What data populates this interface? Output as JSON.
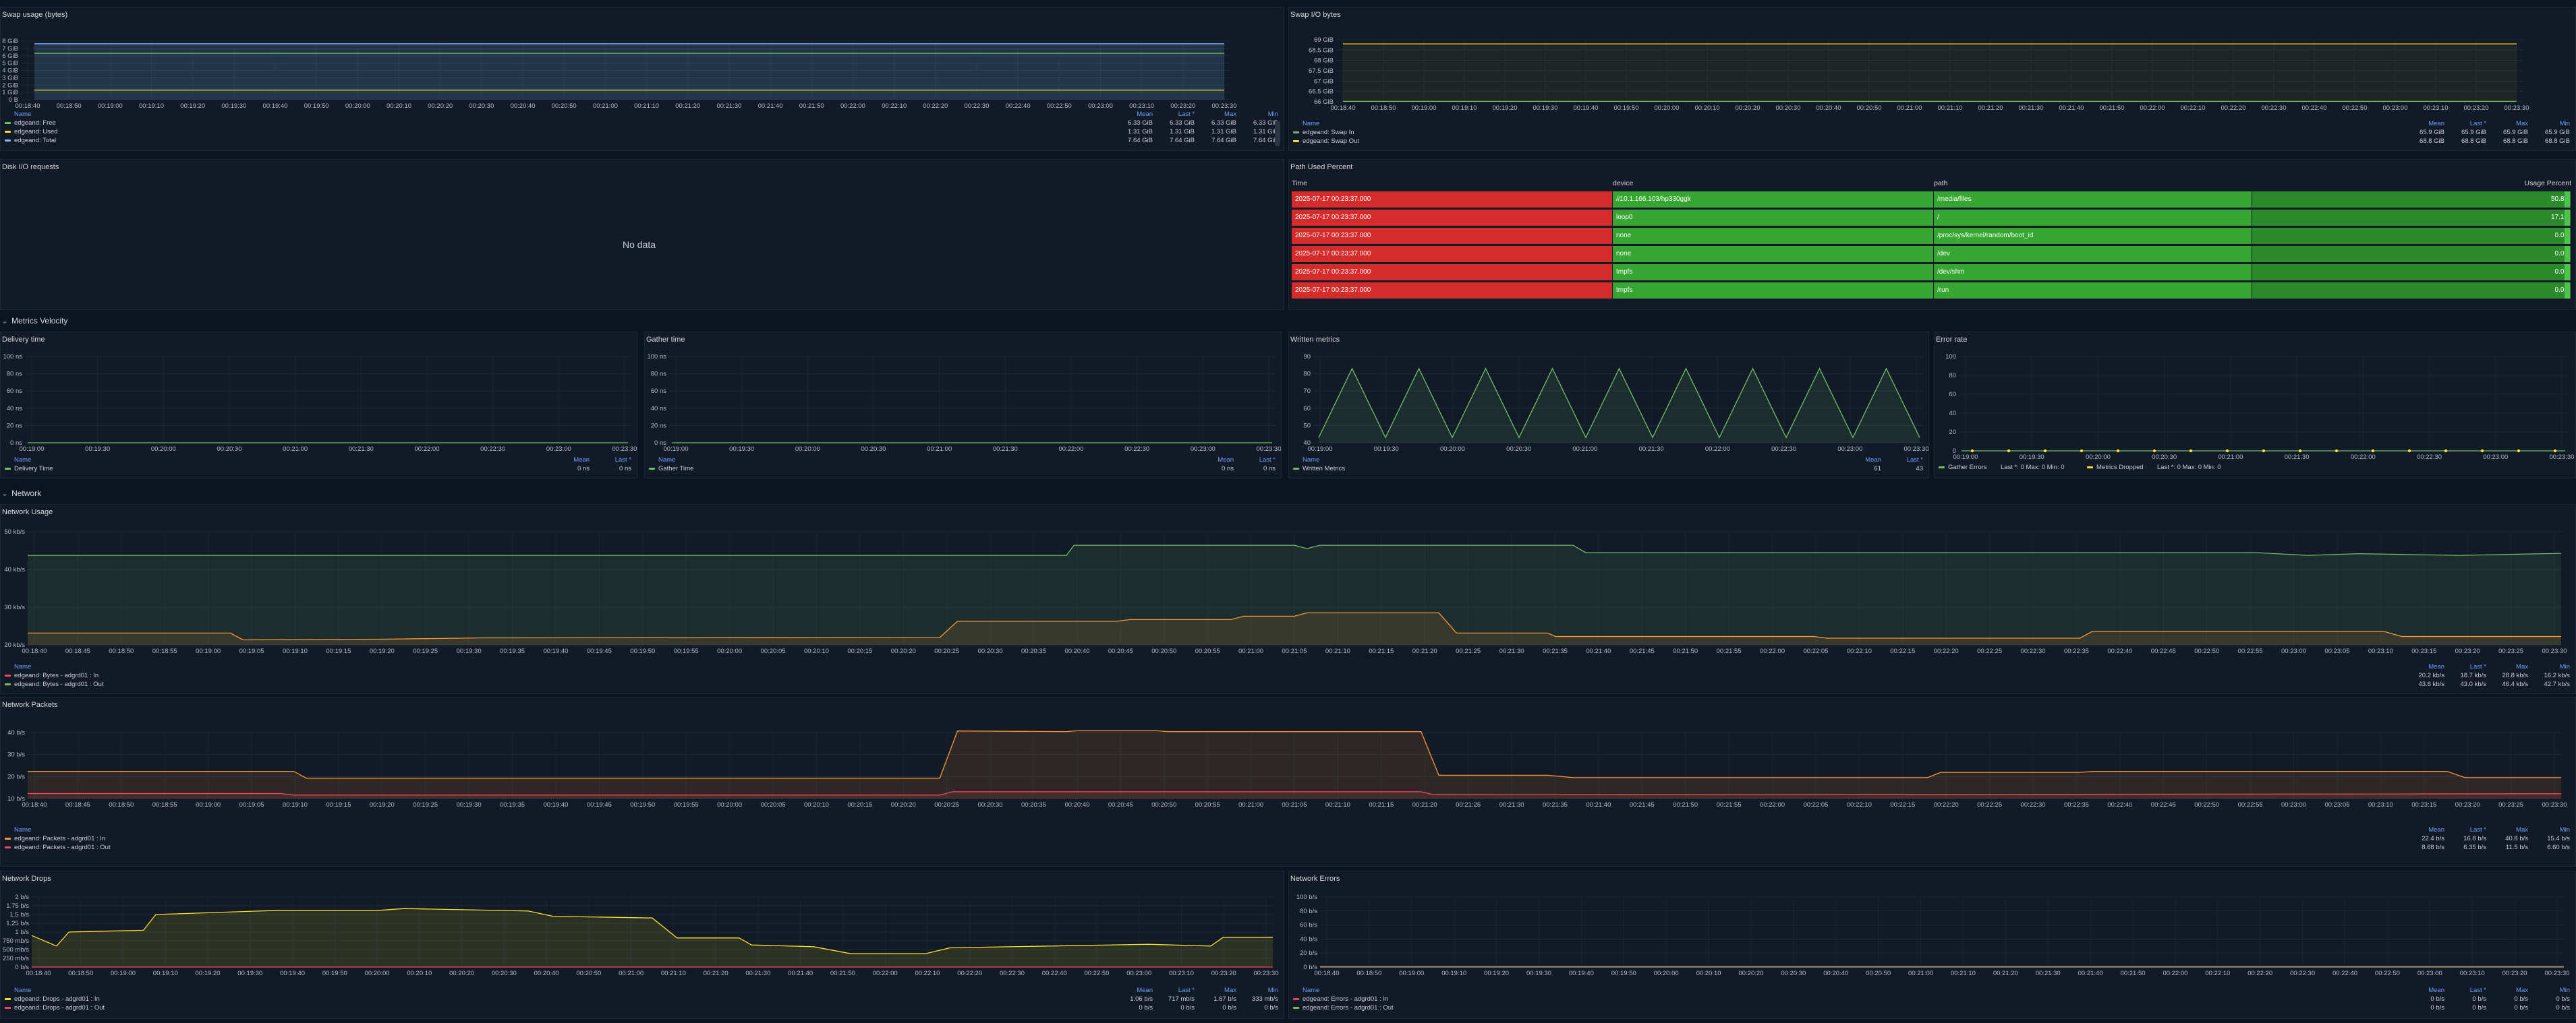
{
  "panels": {
    "swap_usage": {
      "title": "Swap usage (bytes)",
      "y_ticks": [
        "8 GiB",
        "7 GiB",
        "6 GiB",
        "5 GiB",
        "4 GiB",
        "3 GiB",
        "2 GiB",
        "1 GiB",
        "0 B"
      ],
      "x_ticks": [
        "00:18:40",
        "00:18:50",
        "00:19:00",
        "00:19:10",
        "00:19:20",
        "00:19:30",
        "00:19:40",
        "00:19:50",
        "00:20:00",
        "00:20:10",
        "00:20:20",
        "00:20:30",
        "00:20:40",
        "00:20:50",
        "00:21:00",
        "00:21:10",
        "00:21:20",
        "00:21:30",
        "00:21:40",
        "00:21:50",
        "00:22:00",
        "00:22:10",
        "00:22:20",
        "00:22:30",
        "00:22:40",
        "00:22:50",
        "00:23:00",
        "00:23:10",
        "00:23:20",
        "00:23:30"
      ],
      "legend_cols": [
        "Mean",
        "Last *",
        "Max",
        "Min"
      ],
      "legend": [
        {
          "name": "edgeand: Free",
          "color": "#73bf69",
          "vals": [
            "6.33 GiB",
            "6.33 GiB",
            "6.33 GiB",
            "6.33 GiB"
          ]
        },
        {
          "name": "edgeand: Used",
          "color": "#fade2a",
          "vals": [
            "1.31 GiB",
            "1.31 GiB",
            "1.31 GiB",
            "1.31 GiB"
          ]
        },
        {
          "name": "edgeand: Total",
          "color": "#8ab8ff",
          "vals": [
            "7.64 GiB",
            "7.64 GiB",
            "7.64 GiB",
            "7.64 GiB"
          ]
        }
      ]
    },
    "swap_io": {
      "title": "Swap I/O bytes",
      "y_ticks": [
        "69 GiB",
        "68.5 GiB",
        "68 GiB",
        "67.5 GiB",
        "67 GiB",
        "66.5 GiB",
        "66 GiB"
      ],
      "x_ticks": [
        "00:18:40",
        "00:18:50",
        "00:19:00",
        "00:19:10",
        "00:19:20",
        "00:19:30",
        "00:19:40",
        "00:19:50",
        "00:20:00",
        "00:20:10",
        "00:20:20",
        "00:20:30",
        "00:20:40",
        "00:20:50",
        "00:21:00",
        "00:21:10",
        "00:21:20",
        "00:21:30",
        "00:21:40",
        "00:21:50",
        "00:22:00",
        "00:22:10",
        "00:22:20",
        "00:22:30",
        "00:22:40",
        "00:22:50",
        "00:23:00",
        "00:23:10",
        "00:23:20",
        "00:23:30"
      ],
      "legend_cols": [
        "Mean",
        "Last *",
        "Max",
        "Min"
      ],
      "legend": [
        {
          "name": "edgeand: Swap In",
          "color": "#73bf69",
          "vals": [
            "65.9 GiB",
            "65.9 GiB",
            "65.9 GiB",
            "65.9 GiB"
          ]
        },
        {
          "name": "edgeand: Swap Out",
          "color": "#fade2a",
          "vals": [
            "68.8 GiB",
            "68.8 GiB",
            "68.8 GiB",
            "68.8 GiB"
          ]
        }
      ]
    },
    "disk_io": {
      "title": "Disk I/O requests",
      "no_data": "No data"
    },
    "path_used": {
      "title": "Path Used Percent",
      "columns": [
        "Time",
        "device",
        "path",
        "Usage Percent"
      ],
      "rows": [
        {
          "time": "2025-07-17 00:23:37.000",
          "device": "//10.1.166.103/hp330ggk",
          "path": "/media/files",
          "pct": "50.84"
        },
        {
          "time": "2025-07-17 00:23:37.000",
          "device": "loop0",
          "path": "/",
          "pct": "17.10"
        },
        {
          "time": "2025-07-17 00:23:37.000",
          "device": "none",
          "path": "/proc/sys/kernel/random/boot_id",
          "pct": "0.01"
        },
        {
          "time": "2025-07-17 00:23:37.000",
          "device": "none",
          "path": "/dev",
          "pct": "0.01"
        },
        {
          "time": "2025-07-17 00:23:37.000",
          "device": "tmpfs",
          "path": "/dev/shm",
          "pct": "0.01"
        },
        {
          "time": "2025-07-17 00:23:37.000",
          "device": "tmpfs",
          "path": "/run",
          "pct": "0.01"
        }
      ]
    },
    "delivery": {
      "title": "Delivery time",
      "y_ticks": [
        "100 ns",
        "80 ns",
        "60 ns",
        "40 ns",
        "20 ns",
        "0 ns"
      ],
      "x_ticks": [
        "00:19:00",
        "00:19:30",
        "00:20:00",
        "00:20:30",
        "00:21:00",
        "00:21:30",
        "00:22:00",
        "00:22:30",
        "00:23:00",
        "00:23:30"
      ],
      "legend_cols": [
        "Mean",
        "Last *"
      ],
      "legend": [
        {
          "name": "Delivery Time",
          "color": "#73bf69",
          "vals": [
            "0 ns",
            "0 ns"
          ]
        }
      ]
    },
    "gather": {
      "title": "Gather time",
      "y_ticks": [
        "100 ns",
        "80 ns",
        "60 ns",
        "40 ns",
        "20 ns",
        "0 ns"
      ],
      "x_ticks": [
        "00:19:00",
        "00:19:30",
        "00:20:00",
        "00:20:30",
        "00:21:00",
        "00:21:30",
        "00:22:00",
        "00:22:30",
        "00:23:00",
        "00:23:30"
      ],
      "legend_cols": [
        "Mean",
        "Last *"
      ],
      "legend": [
        {
          "name": "Gather Time",
          "color": "#73bf69",
          "vals": [
            "0 ns",
            "0 ns"
          ]
        }
      ]
    },
    "written": {
      "title": "Written metrics",
      "y_ticks": [
        "90",
        "80",
        "70",
        "60",
        "50",
        "40"
      ],
      "x_ticks": [
        "00:19:00",
        "00:19:30",
        "00:20:00",
        "00:20:30",
        "00:21:00",
        "00:21:30",
        "00:22:00",
        "00:22:30",
        "00:23:00",
        "00:23:30"
      ],
      "legend_cols": [
        "Mean",
        "Last *"
      ],
      "legend": [
        {
          "name": "Written Metrics",
          "color": "#73bf69",
          "vals": [
            "61",
            "43"
          ]
        }
      ]
    },
    "error_rate": {
      "title": "Error rate",
      "y_ticks": [
        "100",
        "80",
        "60",
        "40",
        "20",
        "0"
      ],
      "x_ticks": [
        "00:19:00",
        "00:19:30",
        "00:20:00",
        "00:20:30",
        "00:21:00",
        "00:21:30",
        "00:22:00",
        "00:22:30",
        "00:23:00",
        "00:23:30"
      ],
      "legend_inline": [
        {
          "name": "Gather Errors",
          "color": "#73bf69",
          "text": "Last *: 0   Max: 0   Min: 0"
        },
        {
          "name": "Metrics Dropped",
          "color": "#fade2a",
          "text": "Last *: 0   Max: 0   Min: 0"
        }
      ]
    },
    "net_usage": {
      "title": "Network Usage",
      "y_ticks": [
        "50 kb/s",
        "40 kb/s",
        "30 kb/s",
        "20 kb/s"
      ],
      "x_ticks": [
        "00:18:40",
        "00:18:45",
        "00:18:50",
        "00:18:55",
        "00:19:00",
        "00:19:05",
        "00:19:10",
        "00:19:15",
        "00:19:20",
        "00:19:25",
        "00:19:30",
        "00:19:35",
        "00:19:40",
        "00:19:45",
        "00:19:50",
        "00:19:55",
        "00:20:00",
        "00:20:05",
        "00:20:10",
        "00:20:15",
        "00:20:20",
        "00:20:25",
        "00:20:30",
        "00:20:35",
        "00:20:40",
        "00:20:45",
        "00:20:50",
        "00:20:55",
        "00:21:00",
        "00:21:05",
        "00:21:10",
        "00:21:15",
        "00:21:20",
        "00:21:25",
        "00:21:30",
        "00:21:35",
        "00:21:40",
        "00:21:45",
        "00:21:50",
        "00:21:55",
        "00:22:00",
        "00:22:05",
        "00:22:10",
        "00:22:15",
        "00:22:20",
        "00:22:25",
        "00:22:30",
        "00:22:35",
        "00:22:40",
        "00:22:45",
        "00:22:50",
        "00:22:55",
        "00:23:00",
        "00:23:05",
        "00:23:10",
        "00:23:15",
        "00:23:20",
        "00:23:25",
        "00:23:30"
      ],
      "legend_cols": [
        "Mean",
        "Last *",
        "Max",
        "Min"
      ],
      "legend": [
        {
          "name": "edgeand: Bytes - adgrd01 : In",
          "color": "#f2495c",
          "vals": [
            "20.2 kb/s",
            "18.7 kb/s",
            "28.8 kb/s",
            "16.2 kb/s"
          ]
        },
        {
          "name": "edgeand: Bytes - adgrd01 : Out",
          "color": "#73bf69",
          "vals": [
            "43.6 kb/s",
            "43.0 kb/s",
            "46.4 kb/s",
            "42.7 kb/s"
          ]
        }
      ]
    },
    "net_packets": {
      "title": "Network Packets",
      "y_ticks": [
        "40 b/s",
        "30 b/s",
        "20 b/s",
        "10 b/s"
      ],
      "x_ticks": [
        "00:18:40",
        "00:18:45",
        "00:18:50",
        "00:18:55",
        "00:19:00",
        "00:19:05",
        "00:19:10",
        "00:19:15",
        "00:19:20",
        "00:19:25",
        "00:19:30",
        "00:19:35",
        "00:19:40",
        "00:19:45",
        "00:19:50",
        "00:19:55",
        "00:20:00",
        "00:20:05",
        "00:20:10",
        "00:20:15",
        "00:20:20",
        "00:20:25",
        "00:20:30",
        "00:20:35",
        "00:20:40",
        "00:20:45",
        "00:20:50",
        "00:20:55",
        "00:21:00",
        "00:21:05",
        "00:21:10",
        "00:21:15",
        "00:21:20",
        "00:21:25",
        "00:21:30",
        "00:21:35",
        "00:21:40",
        "00:21:45",
        "00:21:50",
        "00:21:55",
        "00:22:00",
        "00:22:05",
        "00:22:10",
        "00:22:15",
        "00:22:20",
        "00:22:25",
        "00:22:30",
        "00:22:35",
        "00:22:40",
        "00:22:45",
        "00:22:50",
        "00:22:55",
        "00:23:00",
        "00:23:05",
        "00:23:10",
        "00:23:15",
        "00:23:20",
        "00:23:25",
        "00:23:30"
      ],
      "legend_cols": [
        "Mean",
        "Last *",
        "Max",
        "Min"
      ],
      "legend": [
        {
          "name": "edgeand: Packets - adgrd01 : In",
          "color": "#ff9830",
          "vals": [
            "22.4 b/s",
            "16.8 b/s",
            "40.8 b/s",
            "15.4 b/s"
          ]
        },
        {
          "name": "edgeand: Packets - adgrd01 : Out",
          "color": "#f2495c",
          "vals": [
            "8.68 b/s",
            "6.35 b/s",
            "11.5 b/s",
            "6.60 b/s"
          ]
        }
      ]
    },
    "net_drops": {
      "title": "Network Drops",
      "y_ticks": [
        "2 b/s",
        "1.75 b/s",
        "1.5 b/s",
        "1.25 b/s",
        "1 b/s",
        "750 mb/s",
        "500 mb/s",
        "250 mb/s",
        "0 b/s"
      ],
      "x_ticks": [
        "00:18:40",
        "00:18:50",
        "00:19:00",
        "00:19:10",
        "00:19:20",
        "00:19:30",
        "00:19:40",
        "00:19:50",
        "00:20:00",
        "00:20:10",
        "00:20:20",
        "00:20:30",
        "00:20:40",
        "00:20:50",
        "00:21:00",
        "00:21:10",
        "00:21:20",
        "00:21:30",
        "00:21:40",
        "00:21:50",
        "00:22:00",
        "00:22:10",
        "00:22:20",
        "00:22:30",
        "00:22:40",
        "00:22:50",
        "00:23:00",
        "00:23:10",
        "00:23:20",
        "00:23:30"
      ],
      "legend_cols": [
        "Mean",
        "Last *",
        "Max",
        "Min"
      ],
      "legend": [
        {
          "name": "edgeand: Drops - adgrd01 : In",
          "color": "#fade2a",
          "vals": [
            "1.06 b/s",
            "717 mb/s",
            "1.67 b/s",
            "333 mb/s"
          ]
        },
        {
          "name": "edgeand: Drops - adgrd01 : Out",
          "color": "#f2495c",
          "vals": [
            "0 b/s",
            "0 b/s",
            "0 b/s",
            "0 b/s"
          ]
        }
      ]
    },
    "net_errors": {
      "title": "Network Errors",
      "y_ticks": [
        "100 b/s",
        "80 b/s",
        "60 b/s",
        "40 b/s",
        "20 b/s",
        "0 b/s"
      ],
      "x_ticks": [
        "00:18:40",
        "00:18:50",
        "00:19:00",
        "00:19:10",
        "00:19:20",
        "00:19:30",
        "00:19:40",
        "00:19:50",
        "00:20:00",
        "00:20:10",
        "00:20:20",
        "00:20:30",
        "00:20:40",
        "00:20:50",
        "00:21:00",
        "00:21:10",
        "00:21:20",
        "00:21:30",
        "00:21:40",
        "00:21:50",
        "00:22:00",
        "00:22:10",
        "00:22:20",
        "00:22:30",
        "00:22:40",
        "00:22:50",
        "00:23:00",
        "00:23:10",
        "00:23:20",
        "00:23:30"
      ],
      "legend_cols": [
        "Mean",
        "Last *",
        "Max",
        "Min"
      ],
      "legend": [
        {
          "name": "edgeand: Errors - adgrd01 : In",
          "color": "#f2495c",
          "vals": [
            "0 b/s",
            "0 b/s",
            "0 b/s",
            "0 b/s"
          ]
        },
        {
          "name": "edgeand: Errors - adgrd01 : Out",
          "color": "#73bf69",
          "vals": [
            "0 b/s",
            "0 b/s",
            "0 b/s",
            "0 b/s"
          ]
        }
      ]
    }
  },
  "rows": {
    "metrics_velocity": "Metrics Velocity",
    "network": "Network"
  },
  "legend_name_header": "Name",
  "colors": {
    "green": "#73bf69",
    "yellow": "#fade2a",
    "red": "#f2495c",
    "orange": "#ff9830",
    "blue": "#8ab8ff",
    "cell_red": "#d62b2b",
    "cell_green": "#37a532"
  }
}
